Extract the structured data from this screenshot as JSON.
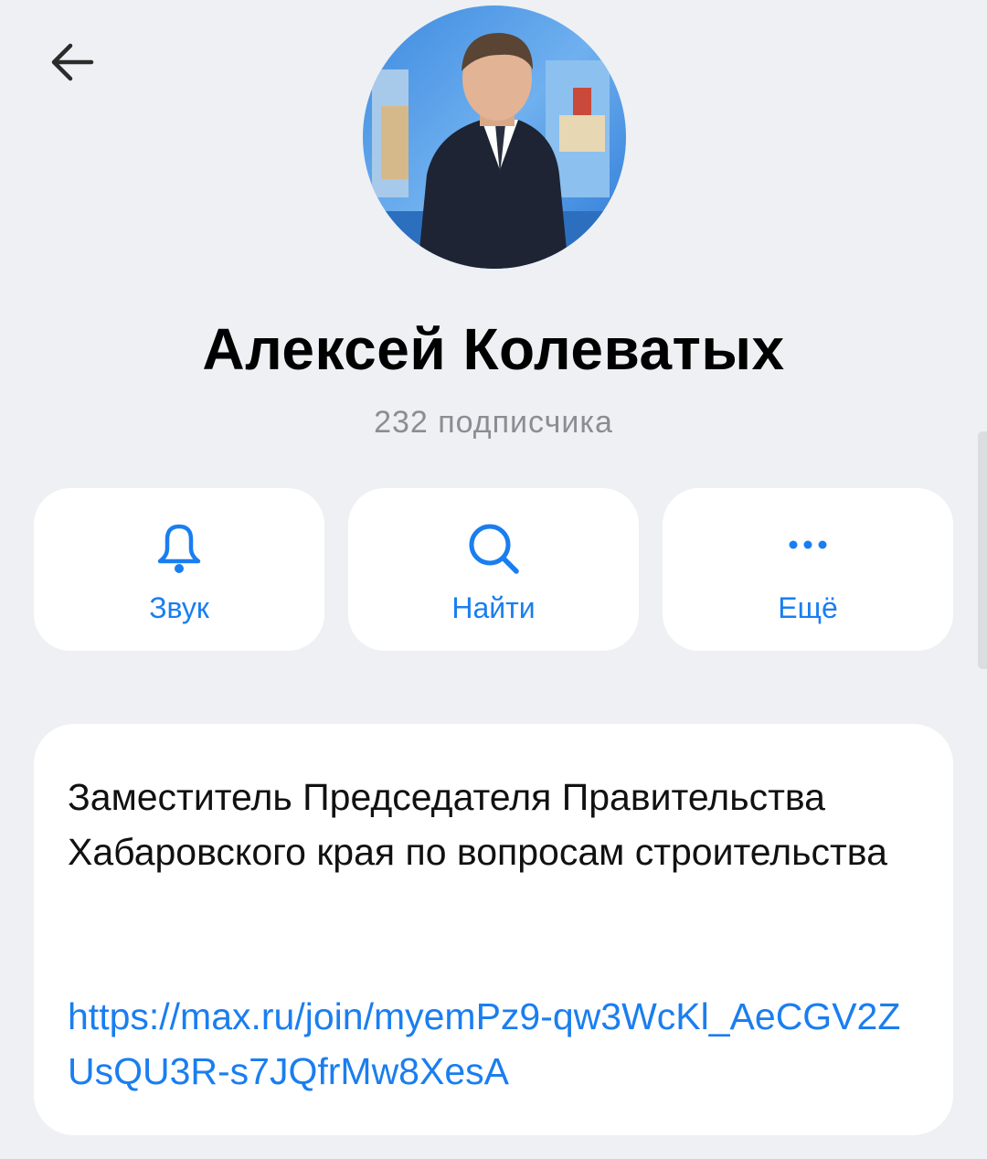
{
  "header": {
    "back_icon": "arrow-left-icon"
  },
  "profile": {
    "name": "Алексей Колеватых",
    "subscribers": "232 подписчика"
  },
  "actions": [
    {
      "label": "Звук",
      "icon": "bell-icon"
    },
    {
      "label": "Найти",
      "icon": "search-icon"
    },
    {
      "label": "Ещё",
      "icon": "more-dots-icon"
    }
  ],
  "about": {
    "description": "Заместитель Председателя Правительства Хабаровского края по вопросам строительства",
    "link": "https://max.ru/join/myemPz9-qw3WcKl_AeCGV2ZUsQU3R-s7JQfrMw8XesA"
  },
  "colors": {
    "background": "#eef0f3",
    "card": "#ffffff",
    "accent": "#1a7ef0",
    "secondary_text": "#8a8d93"
  }
}
